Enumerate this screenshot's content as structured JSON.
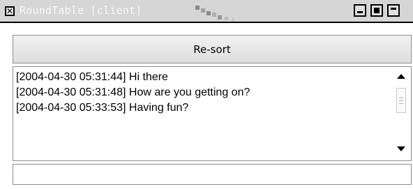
{
  "window": {
    "title": "RoundTable [client]"
  },
  "toolbar": {
    "resort_label": "Re-sort"
  },
  "messages": [
    {
      "timestamp": "[2004-04-30 05:31:44]",
      "text": "Hi there"
    },
    {
      "timestamp": "[2004-04-30 05:31:48]",
      "text": "How are you getting on?"
    },
    {
      "timestamp": "[2004-04-30 05:33:53]",
      "text": "Having fun?"
    }
  ],
  "input": {
    "value": "",
    "placeholder": ""
  },
  "icons": {
    "close": "close-icon",
    "minimize": "minimize-icon",
    "maximize": "maximize-icon",
    "shade": "shade-icon",
    "scroll_up": "arrow-up-icon",
    "scroll_down": "arrow-down-icon"
  },
  "colors": {
    "titlebar": "#d6d6d6",
    "border": "#8c8c8c",
    "text": "#000000"
  }
}
